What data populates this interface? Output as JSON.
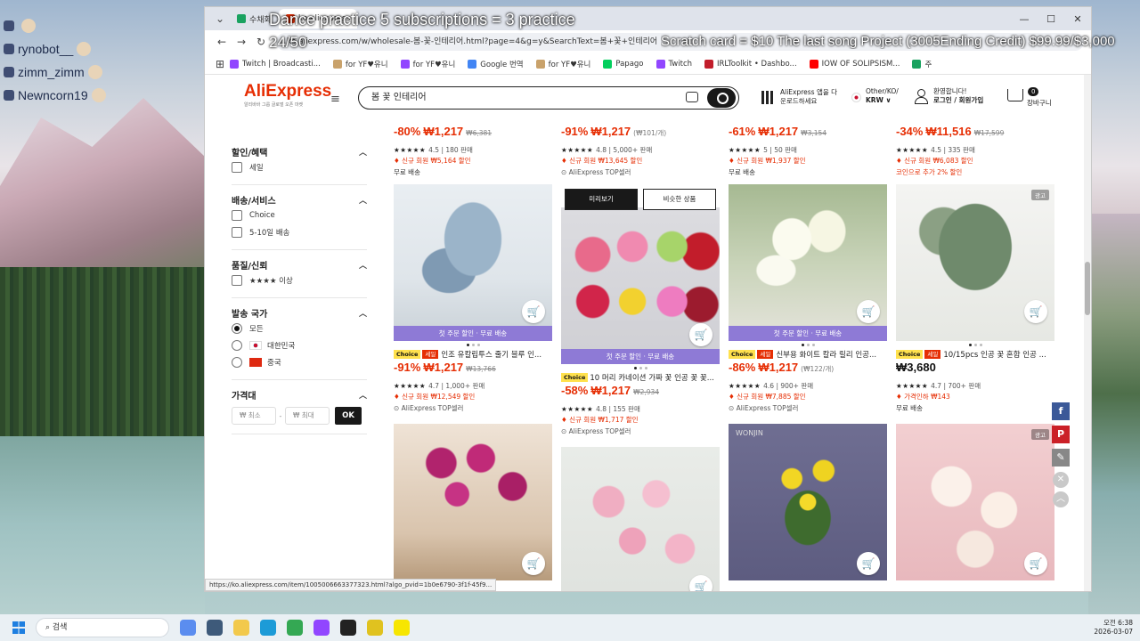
{
  "stream": {
    "chat": [
      "",
      "rynobot__",
      "zimm_zimm",
      "Newncorn19"
    ],
    "title": "Dance practice 5 subscriptions = 3 practice",
    "counter": "24/50",
    "ticker": "Scratch card = $10 The last song Project (3005Ending Credit) $99.99/$3,000"
  },
  "browser": {
    "tabs": [
      "수채화",
      "ko.aliexpress"
    ],
    "url": "ko.aliexpress.com/w/wholesale-봄-꽃-인테리어.html?page=4&g=y&SearchText=봄+꽃+인테리어",
    "bookmarks": [
      "Twitch | Broadcasti...",
      "for YF♥유니",
      "for YF♥유니",
      "Google 번역",
      "for YF♥유니",
      "Papago",
      "Twitch",
      "IRLToolkit • Dashbo...",
      "IOW OF SOLIPSISM...",
      "주"
    ],
    "status_url": "https://ko.aliexpress.com/item/1005006663377323.html?algo_pvid=1b0e6790-3f1f-45f9..."
  },
  "header": {
    "logo": "AliExpress",
    "logo_sub": "알리바바 그룹 글로벌 오픈 마켓",
    "search_value": "봄 꽃 인테리어",
    "app_text": "AliExpress 앱을 다\n운로드하세요",
    "locale_top": "Other/KO/",
    "locale_bottom": "KRW ∨",
    "user_top": "환영합니다!",
    "user_bottom": "로그인 / 회원가입",
    "cart_count": "0",
    "cart_label": "장바구니"
  },
  "filters": [
    {
      "title": "할인/혜택",
      "type": "checkbox",
      "options": [
        "세일"
      ]
    },
    {
      "title": "배송/서비스",
      "type": "checkbox",
      "options": [
        "Choice",
        "5-10일 배송"
      ]
    },
    {
      "title": "품질/신뢰",
      "type": "checkbox",
      "options": [
        "★★★★ 이상"
      ]
    },
    {
      "title": "발송 국가",
      "type": "radio",
      "options": [
        "모든",
        "대한민국",
        "중국"
      ],
      "selected": 0
    },
    {
      "title": "가격대",
      "type": "price",
      "min_placeholder": "₩ 최소",
      "max_placeholder": "₩ 최대",
      "ok": "OK"
    }
  ],
  "popup": {
    "preview": "미리보기",
    "similar": "비슷한 상품"
  },
  "products_top": [
    {
      "title": "...",
      "discount": "-80%",
      "price": "₩1,217",
      "old": "₩6,381",
      "rating": "4.5",
      "sold": "180 판매",
      "promo": "신규 회원 ₩5,164 할인",
      "extra": "무료 배송"
    },
    {
      "title": "...",
      "discount": "-91%",
      "price": "₩1,217",
      "unit": "(₩101/개)",
      "rating": "4.8",
      "sold": "5,000+ 판매",
      "promo": "신규 회원 ₩13,645 할인",
      "extra": "AliExpress TOP셀러"
    },
    {
      "title": "...",
      "discount": "-61%",
      "price": "₩1,217",
      "old": "₩3,154",
      "rating": "5",
      "sold": "50 판매",
      "promo": "신규 회원 ₩1,937 할인",
      "extra": "무료 배송"
    },
    {
      "title": "...",
      "discount": "-34%",
      "price": "₩11,516",
      "old": "₩17,599",
      "rating": "4.5",
      "sold": "335 판매",
      "promo": "신규 회원 ₩6,083 할인",
      "extra": "코인으로 추가 2% 할인"
    }
  ],
  "products_mid": [
    {
      "strip": "첫 주문 할인 · 무료 배송",
      "title": "인조 유칼립투스 줄기 블루 인...",
      "discount": "-91%",
      "price": "₩1,217",
      "old": "₩13,766",
      "rating": "4.7",
      "sold": "1,000+ 판매",
      "promo": "신규 회원 ₩12,549 할인",
      "seller": "AliExpress TOP셀러"
    },
    {
      "strip": "첫 주문 할인 · 무료 배송",
      "title": "10 머리 카네이션 가짜 꽃 인공 꽃 꽃...",
      "discount": "-58%",
      "price": "₩1,217",
      "old": "₩2,934",
      "rating": "4.8",
      "sold": "155 판매",
      "promo": "신규 회원 ₩1,717 할인",
      "seller": "AliExpress TOP셀러"
    },
    {
      "strip": "첫 주문 할인 · 무료 배송",
      "title": "신부용 화이트 칼라 릴리 인공...",
      "discount": "-86%",
      "price": "₩1,217",
      "unit": "(₩122/개)",
      "rating": "4.6",
      "sold": "900+ 판매",
      "promo": "신규 회원 ₩7,885 할인",
      "seller": "AliExpress TOP셀러"
    },
    {
      "strip": "",
      "ad": "광고",
      "title": "10/15pcs 인공 꽃 혼합 인공 ...",
      "discount": "",
      "price": "₩3,680",
      "rating": "4.7",
      "sold": "700+ 판매",
      "promo": "가격인하 ₩143",
      "seller": "무료 배송"
    }
  ],
  "bottom_labels": {
    "wonjin": "WONJIN",
    "ad": "광고"
  },
  "labels": {
    "choice": "Choice",
    "sale": "세일",
    "cart_glyph": "🛒"
  },
  "taskbar": {
    "search": "검색",
    "time": "오전 6:38",
    "date": "2026-03-07"
  }
}
